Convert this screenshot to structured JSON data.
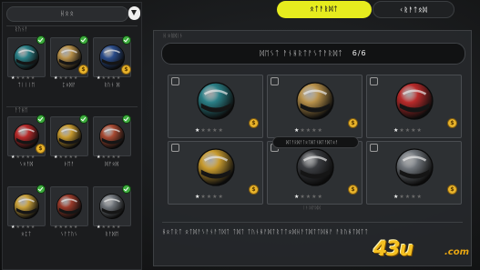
{
  "left_panel": {
    "filter_label": "ᚺᛟᛟ",
    "filter_icon": "funnel-icon",
    "sections": [
      {
        "label": "ᚱᚢᚾᚨ"
      },
      {
        "label": "ᚨᛏᚺᛖ"
      }
    ],
    "items": [
      {
        "name": "ᛏᛁᛁᛁᛖ",
        "owned": true,
        "color": "#2a7f86",
        "stars_filled": 1,
        "coin": false
      },
      {
        "name": "ᛈᛟᛞᚨ",
        "owned": true,
        "color": "#b8914a",
        "stars_filled": 1,
        "coin": true
      },
      {
        "name": "ᚱᚢᚾ ᛞ",
        "owned": true,
        "color": "#2a4c8a",
        "stars_filled": 1,
        "coin": true
      },
      {
        "name": "ᛊᛟᚨᛞ",
        "owned": true,
        "color": "#b82a2a",
        "stars_filled": 1,
        "coin": true
      },
      {
        "name": "ᚦᛖᚨ",
        "owned": true,
        "color": "#c79a2e",
        "stars_filled": 1,
        "coin": false
      },
      {
        "name": "ᛞᚠᛟᛞ",
        "owned": true,
        "color": "#a84a32",
        "stars_filled": 1,
        "coin": false
      },
      {
        "name": "ᛟᛈᛏ",
        "owned": true,
        "color": "#c8a03a",
        "stars_filled": 1,
        "coin": false
      },
      {
        "name": "ᛊᚨᛏᚢᛊ",
        "owned": false,
        "color": "#9a3a2a",
        "stars_filled": 0,
        "coin": false
      },
      {
        "name": "ᚱᚨᛞᛖ",
        "owned": true,
        "color": "#6f747a",
        "stars_filled": 1,
        "coin": false
      }
    ]
  },
  "tabs": {
    "active_label": "ᛟᛏᚨᚱᛞᛏ",
    "inactive_label": "ᚲᚱᚨᛏᛟᛞ"
  },
  "main_panel": {
    "header": "ᚺ ᛟᚱᛞᛁᚾ",
    "title": "ᛞᛖᛊᛏ ᚨᚾᚺᚱᛏᚨᛊᛏᚨᚱᛞᛏ",
    "count": "6/6",
    "items": [
      {
        "color": "#2a7f86",
        "coin": true,
        "stars_filled": 1
      },
      {
        "color": "#b8914a",
        "coin": true,
        "stars_filled": 1
      },
      {
        "color": "#b82a2a",
        "coin": true,
        "stars_filled": 1
      },
      {
        "color": "#c79a2e",
        "coin": true,
        "stars_filled": 1
      },
      {
        "color": "#3a3c40",
        "coin": true,
        "stars_filled": 1
      },
      {
        "color": "#6f747a",
        "coin": true,
        "stars_filled": 1
      }
    ],
    "hint_text": "ᛞᛏᚨᚱᛞᚨᛏᛟᛏᛞᛏᚾᛞᛏᚨᛞᛏᛟᚨ",
    "divider_label": "ᛁᚾ ᛞᚨᛞᛞ",
    "description": "ᚺᛟᛏᚱᛏ ᛟᛏᛞᚨᛊᚨᚾᚨᛏᛞᛏ ᛏᛞᛏ ᛏᚢᚾᚺᚨᛞᛏᚱᛏᛏᛟᛞᚺᚨᛏᛞᛏᛏᛞᚺᚨ ᚨᚱᚢᚺᛏᛞᛏᛏ"
  },
  "watermark": {
    "text": "43u",
    "suffix": ".com"
  }
}
